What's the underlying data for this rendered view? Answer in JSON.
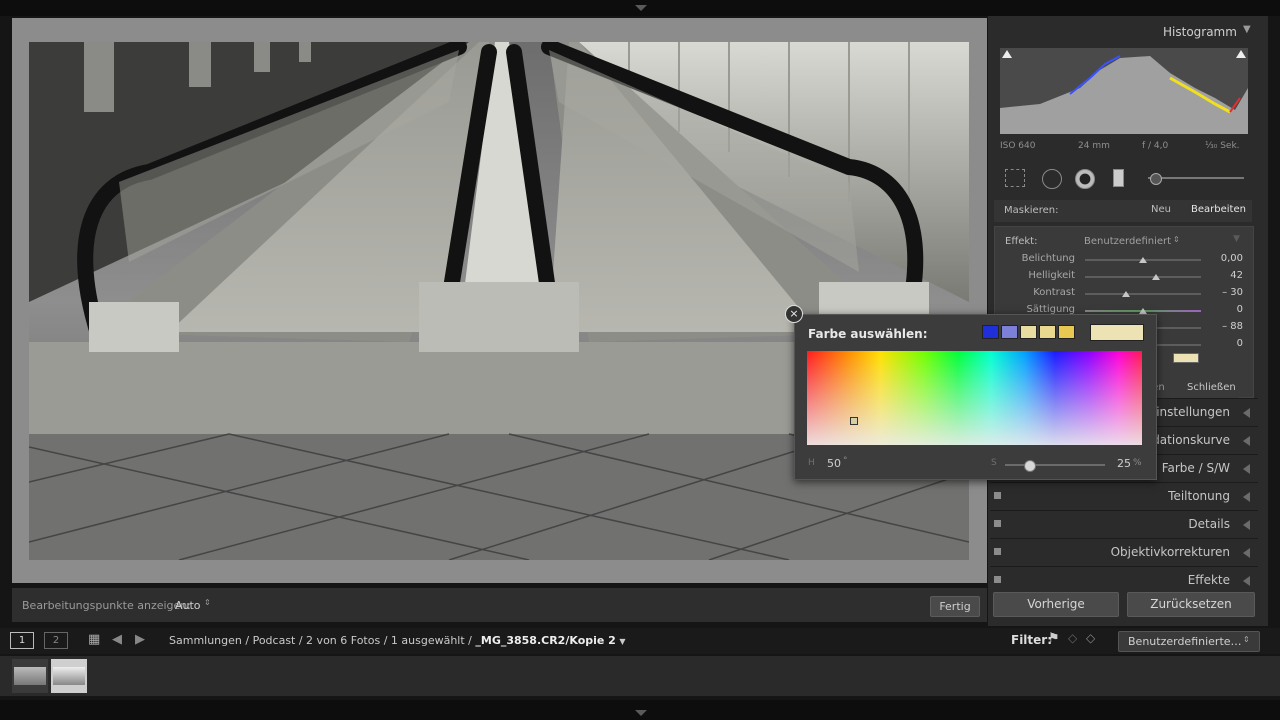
{
  "photo_toolbar": {
    "edit_points_label": "Bearbeitungspunkte anzeigen:",
    "edit_points_value": "Auto",
    "done_label": "Fertig"
  },
  "histogram": {
    "title": "Histogramm",
    "iso": "ISO 640",
    "focal": "24 mm",
    "aperture": "f / 4,0",
    "shutter": "¹⁄₃₀ Sek."
  },
  "mask": {
    "label": "Maskieren:",
    "new_label": "Neu",
    "edit_label": "Bearbeiten",
    "effect_label": "Effekt:",
    "effect_value": "Benutzerdefiniert",
    "rows": [
      {
        "label": "Belichtung",
        "value": "0,00",
        "pos": 0.5
      },
      {
        "label": "Helligkeit",
        "value": "42",
        "pos": 0.61
      },
      {
        "label": "Kontrast",
        "value": "– 30",
        "pos": 0.35
      },
      {
        "label": "Sättigung",
        "value": "0",
        "pos": 0.5
      },
      {
        "label": "",
        "value": "– 88",
        "pos": 0.5
      },
      {
        "label": "",
        "value": "0",
        "pos": 0.5
      }
    ],
    "reset_label": "zen",
    "close_label": "Schließen"
  },
  "color_picker": {
    "title": "Farbe auswählen:",
    "swatches": [
      "#2030d8",
      "#7c80d8",
      "#e8dca0",
      "#e8d890",
      "#e8c850"
    ],
    "current_color": "#ece2b4",
    "h_label": "H",
    "h_value": "50",
    "s_label": "S",
    "s_value": "25",
    "s_fraction": 0.25,
    "percent_sign": "%",
    "degree_sign": "°"
  },
  "sections": [
    {
      "title": "einstellungen"
    },
    {
      "title": "dationskurve"
    },
    {
      "title": "Farbe / S/W"
    },
    {
      "title": "Teiltonung"
    },
    {
      "title": "Details"
    },
    {
      "title": "Objektivkorrekturen"
    },
    {
      "title": "Effekte"
    }
  ],
  "bottom_buttons": {
    "prev": "Vorherige",
    "reset": "Zurücksetzen"
  },
  "filmstrip_header": {
    "view1": "1",
    "view2": "2",
    "breadcrumb_prefix": "Sammlungen / Podcast / 2 von 6 Fotos / 1 ausgewählt / ",
    "breadcrumb_file": "_MG_3858.CR2/Kopie 2",
    "filter_label": "Filter:",
    "filter_value": "Benutzerdefinierte…"
  }
}
